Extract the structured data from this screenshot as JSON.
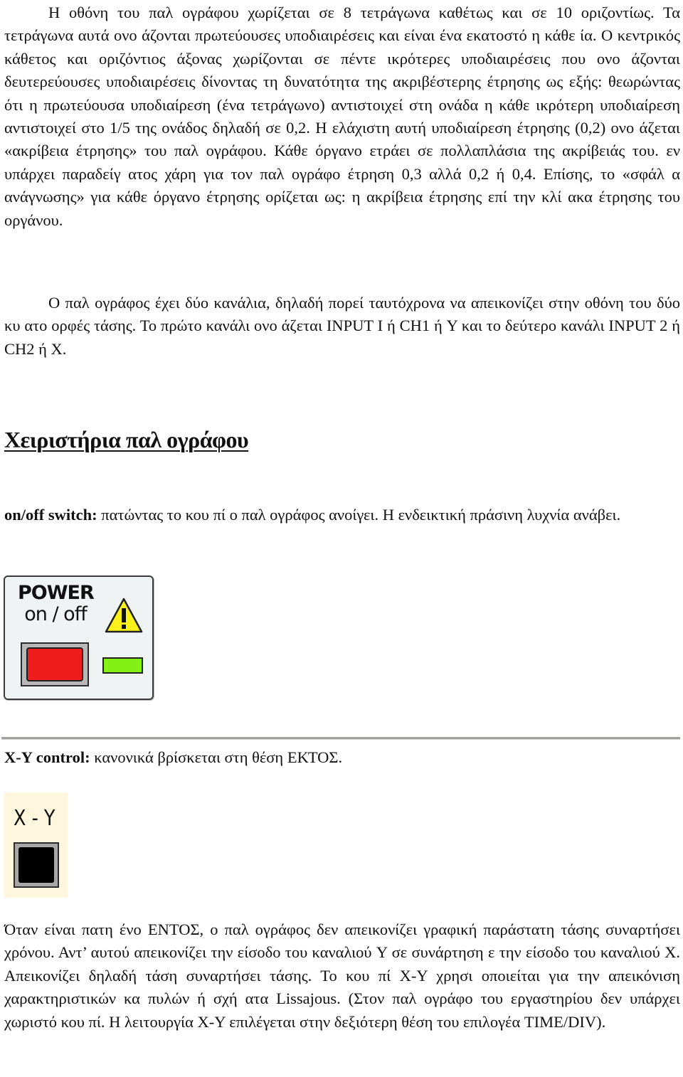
{
  "document": {
    "paragraph_1": "Η οθόνη του παλ  ογράφου χωρίζεται σε 8 τετράγωνα καθέτως και σε 10 οριζοντίως. Τα τετράγωνα αυτά ονο άζονται πρωτεύουσες υποδιαιρέσεις και είναι ένα εκατοστό η κάθε  ία. Ο κεντρικός κάθετος και οριζόντιος άξονας χωρίζονται σε πέντε  ικρότερες υποδιαιρέσεις που ονο άζονται δευτερεύουσες υποδιαιρέσεις δίνοντας τη δυνατότητα της ακριβέστερης  έτρησης ως εξής: θεωρώντας ότι η πρωτεύουσα υποδιαίρεση (ένα τετράγωνο) αντιστοιχεί στη  ονάδα η κάθε  ικρότερη υποδιαίρεση αντιστοιχεί στο 1/5 της  ονάδος δηλαδή σε 0,2. Η ελάχιστη αυτή υποδιαίρεση  έτρησης (0,2) ονο άζεται «ακρίβεια  έτρησης» του παλ ογράφου. Κάθε όργανο  ετράει σε πολλαπλάσια της ακρίβειάς του.  εν υπάρχει παραδείγ ατος χάρη για τον παλ ογράφο  έτρηση 0,3 αλλά 0,2 ή 0,4. Επίσης, το «σφάλ α ανάγνωσης» για κάθε όργανο  έτρησης ορίζεται ως: η ακρίβεια  έτρησης επί την κλί ακα  έτρησης του οργάνου.",
    "paragraph_2": "Ο παλ  ογράφος έχει δύο κανάλια, δηλαδή   πορεί ταυτόχρονα να απεικονίζει στην οθόνη του δύο κυ  ατο  ορφές τάσης. Το πρώτο κανάλι ονο  άζεται INPUT I ή CH1 ή Y και το δεύτερο κανάλι INPUT 2 ή CH2 ή X.",
    "section_heading": "Χειριστήρια παλ  ογράφου",
    "onoff": {
      "label": "on/off switch:",
      "text": " πατώντας το κου  πί ο παλ  ογράφος ανοίγει. Η ενδεικτική πράσινη λυχνία ανάβει."
    },
    "power_panel": {
      "title": "POWER",
      "subtitle": "on / off",
      "warning_icon": "warning-triangle-icon",
      "button_color": "#ef1d1d",
      "lamp_color": "#84f116"
    },
    "xy": {
      "label": "X-Y control:",
      "text": " κανονικά βρίσκεται στη θέση ΕΚΤΟΣ."
    },
    "xy_panel": {
      "title": "X - Y",
      "button_color": "#000000"
    },
    "paragraph_3": "Όταν είναι πατη  ένο ΕΝΤΟΣ, ο παλ  ογράφος δεν απεικονίζει γραφική παράστατη τάσης συναρτήσει χρόνου. Αντ’ αυτού απεικονίζει την είσοδο του καναλιού Y σε συνάρτηση   ε την είσοδο του καναλιού X. Απεικονίζει δηλαδή τάση συναρτήσει τάσης. Το κου  πί X-Y χρησι οποιείται για την απεικόνιση χαρακτηριστικών κα  πυλών ή σχή  ατα Lissajous. (Στον παλ  ογράφο του εργαστηρίου δεν υπάρχει χωριστό κου  πί. Η λειτουργία X-Y επιλέγεται στην δεξιότερη θέση του επιλογέα TIME/DIV)."
  }
}
